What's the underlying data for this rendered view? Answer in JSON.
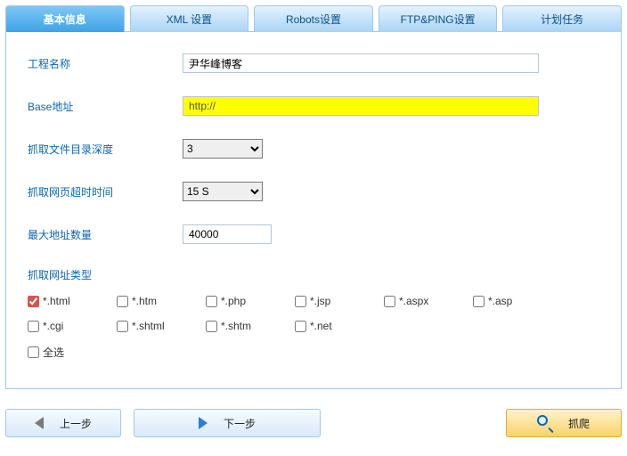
{
  "tabs": [
    {
      "label": "基本信息",
      "active": true
    },
    {
      "label": "XML 设置",
      "active": false
    },
    {
      "label": "Robots设置",
      "active": false
    },
    {
      "label": "FTP&PING设置",
      "active": false
    },
    {
      "label": "计划任务",
      "active": false
    }
  ],
  "form": {
    "project_name_label": "工程名称",
    "project_name_value": "尹华峰博客",
    "base_url_label": "Base地址",
    "base_url_value": "http://",
    "crawl_depth_label": "抓取文件目录深度",
    "crawl_depth_value": "3",
    "timeout_label": "抓取网页超时时间",
    "timeout_value": "15 S",
    "max_urls_label": "最大地址数量",
    "max_urls_value": "40000",
    "url_types_label": "抓取网址类型",
    "types": [
      {
        "label": "*.html",
        "checked": true
      },
      {
        "label": "*.htm",
        "checked": false
      },
      {
        "label": "*.php",
        "checked": false
      },
      {
        "label": "*.jsp",
        "checked": false
      },
      {
        "label": "*.aspx",
        "checked": false
      },
      {
        "label": "*.asp",
        "checked": false
      },
      {
        "label": "*.cgi",
        "checked": false
      },
      {
        "label": "*.shtml",
        "checked": false
      },
      {
        "label": "*.shtm",
        "checked": false
      },
      {
        "label": "*.net",
        "checked": false
      }
    ],
    "select_all_label": "全选",
    "select_all_checked": false
  },
  "buttons": {
    "prev": "上一步",
    "next": "下一步",
    "crawl": "抓爬"
  }
}
